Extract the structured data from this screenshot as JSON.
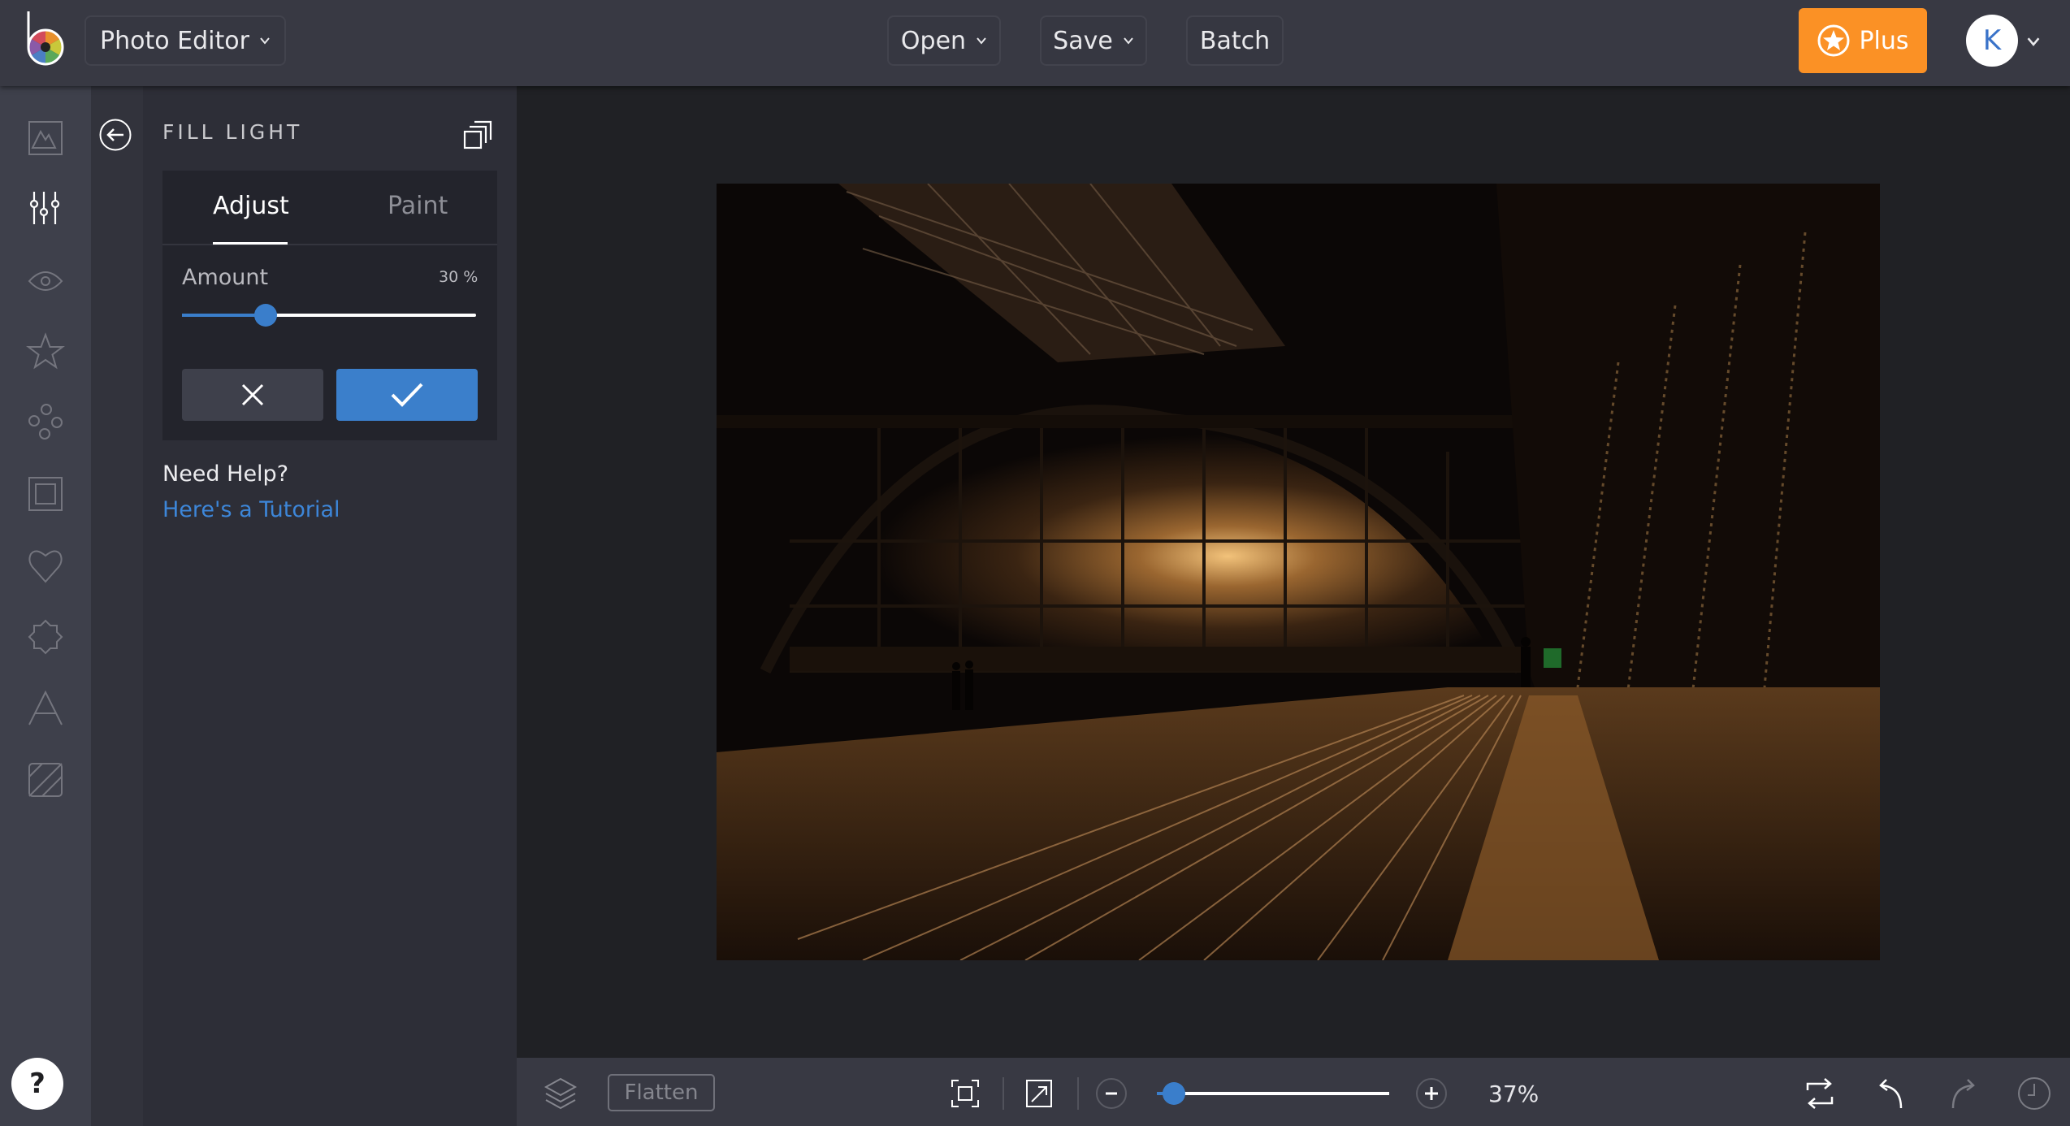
{
  "topbar": {
    "app_switcher_label": "Photo Editor",
    "open_label": "Open",
    "save_label": "Save",
    "batch_label": "Batch",
    "plus_label": "Plus",
    "avatar_initial": "K"
  },
  "rail": {
    "items": [
      {
        "name": "image",
        "icon": "image-icon"
      },
      {
        "name": "edit",
        "icon": "sliders-icon",
        "active": true
      },
      {
        "name": "touch-up",
        "icon": "eye-icon"
      },
      {
        "name": "effects",
        "icon": "star-icon"
      },
      {
        "name": "graphics",
        "icon": "circles-icon"
      },
      {
        "name": "frames",
        "icon": "frame-icon"
      },
      {
        "name": "overlays",
        "icon": "heart-icon"
      },
      {
        "name": "stickers",
        "icon": "badge-icon"
      },
      {
        "name": "text",
        "icon": "text-icon"
      },
      {
        "name": "textures",
        "icon": "texture-icon"
      }
    ],
    "help_label": "?"
  },
  "panel": {
    "title": "FILL LIGHT",
    "tabs": [
      {
        "label": "Adjust",
        "active": true
      },
      {
        "label": "Paint",
        "active": false
      }
    ],
    "amount_label": "Amount",
    "amount_value_text": "30 %",
    "amount_fraction": 0.3,
    "help_heading": "Need Help?",
    "help_link": "Here's a Tutorial"
  },
  "bottombar": {
    "flatten_label": "Flatten",
    "zoom_text": "37%",
    "zoom_fraction": 0.06
  },
  "colors": {
    "accent_blue": "#3b7fcb",
    "plus_orange": "#fb9125",
    "link_blue": "#3d86d8"
  }
}
